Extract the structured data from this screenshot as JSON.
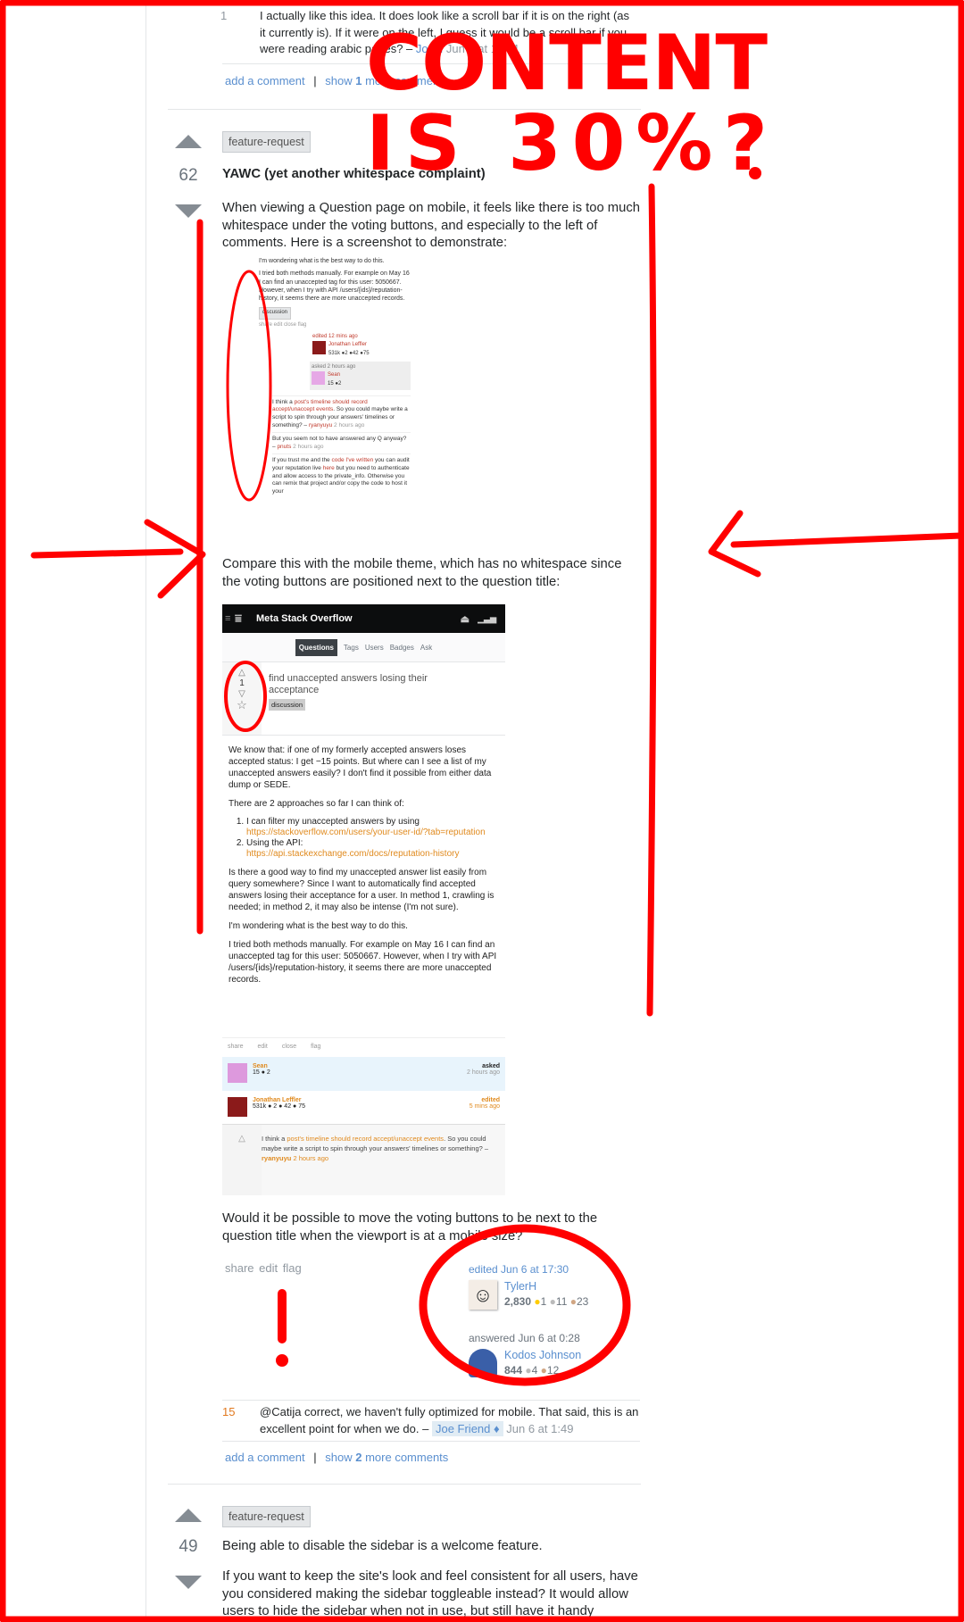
{
  "top_comment": {
    "score": "1",
    "text": "I actually like this idea. It does look like a scroll bar if it is on the right (as it currently is). If it were on the left, I guess it would be a scroll bar if you were reading arabic pages? –",
    "user": "JonH",
    "time": "Jun 7 at 14:51"
  },
  "top_links": {
    "add_comment": "add a comment",
    "sep": "|",
    "show_prefix": "show",
    "show_count": "1",
    "show_suffix": "more comment"
  },
  "answer1": {
    "score": "62",
    "tag": "feature-request",
    "title": "YAWC (yet another whitespace complaint)",
    "intro": "When viewing a Question page on mobile, it feels like there is too much whitespace under the voting buttons, and especially to the left of comments. Here is a screenshot to demonstrate:",
    "compare": "Compare this with the mobile theme, which has no whitespace since the voting buttons are positioned next to the question title:",
    "closing": "Would it be possible to move the voting buttons to be next to the question title when the viewport is at a mobile size?",
    "actions": {
      "share": "share",
      "edit": "edit",
      "flag": "flag"
    },
    "edited": {
      "label": "edited Jun 6 at 17:30",
      "user": "TylerH",
      "rep": "2,830",
      "gold": "1",
      "silver": "11",
      "bronze": "23"
    },
    "answered": {
      "label": "answered Jun 6 at 0:28",
      "user": "Kodos Johnson",
      "rep": "844",
      "silver": "4",
      "bronze": "12"
    },
    "comment": {
      "score": "15",
      "text": "@Catija correct, we haven't fully optimized for mobile. That said, this is an excellent point for when we do. –",
      "user": "Joe Friend ♦",
      "time": "Jun 6 at 1:49"
    },
    "links": {
      "add_comment": "add a comment",
      "sep": "|",
      "show_prefix": "show",
      "show_count": "2",
      "show_suffix": "more comments"
    }
  },
  "screenshot1": {
    "p1": "I'm wondering what is the best way to do this.",
    "p2": "I tried both methods manually. For example on May 16 I can find an unaccepted tag for this user: 5050667. However, when I try with API /users/{ids}/reputation-history, it seems there are more unaccepted records.",
    "tag": "discussion",
    "actions": "share edit close flag",
    "edited": "edited 12 mins ago",
    "editor": "Jonathan Leffler",
    "editor_rep": "531k ●2 ●42 ●75",
    "asked": "asked 2 hours ago",
    "asker": "Sean",
    "asker_rep": "15 ●2",
    "c1_pre": "I think a ",
    "c1_link": "post's timeline should record accept/unaccept events",
    "c1_post": ". So you could maybe write a script to spin through your answers' timelines or something? –",
    "c1_user": "ryanyuyu",
    "c1_time": "2 hours ago",
    "c2": "But you seem not to have answered any Q anyway? –",
    "c2_user": "pnuts",
    "c2_time": "2 hours ago",
    "c3_pre": "If you trust me and the ",
    "c3_link": "code I've written",
    "c3_mid": " you can audit your reputation live ",
    "c3_link2": "here",
    "c3_post": " but you need to authenticate and allow access to the private_info. Otherwise you can remix that project and/or copy the code to host it your"
  },
  "mobile": {
    "site": "Meta Stack Overflow",
    "nav": [
      "Questions",
      "Tags",
      "Users",
      "Badges",
      "Ask"
    ],
    "votes": "1",
    "title": "find unaccepted answers losing their acceptance",
    "tag": "discussion",
    "p1": "We know that: if one of my formerly accepted answers loses accepted status: I get −15 points. But where can I see a list of my unaccepted answers easily? I don't find it possible from either data dump or SEDE.",
    "p2": "There are 2 approaches so far I can think of:",
    "li1": "I can filter my unaccepted answers by using",
    "li1_link": "https://stackoverflow.com/users/your-user-id/?tab=reputation",
    "li2": "Using the API:",
    "li2_link": "https://api.stackexchange.com/docs/reputation-history",
    "p3": "Is there a good way to find my unaccepted answer list easily from query somewhere? Since I want to automatically find accepted answers losing their acceptance for a user. In method 1, crawling is needed; in method 2, it may also be intense (I'm not sure).",
    "p4": "I'm wondering what is the best way to do this.",
    "p5": "I tried both methods manually. For example on May 16 I can find an unaccepted tag for this user: 5050667. However, when I try with API /users/{ids}/reputation-history, it seems there are more unaccepted records.",
    "actions": [
      "share",
      "edit",
      "close",
      "flag"
    ],
    "asker": "Sean",
    "asker_rep": "15 ● 2",
    "asked": "asked",
    "asked_time": "2 hours ago",
    "editor": "Jonathan Leffler",
    "editor_rep": "531k ● 2 ● 42 ● 75",
    "edited": "edited",
    "edited_time": "5 mins ago",
    "comment_pre": "I think a ",
    "comment_link": "post's timeline should record accept/unaccept events",
    "comment_post": ". So you could maybe write a script to spin through your answers' timelines or something? –",
    "comment_user": "ryanyuyu",
    "comment_time": "2 hours ago"
  },
  "answer2": {
    "score": "49",
    "tag": "feature-request",
    "p1": "Being able to disable the sidebar is a welcome feature.",
    "p2": "If you want to keep the site's look and feel consistent for all users, have you considered making the sidebar toggleable instead? It would allow users to hide the sidebar when not in use, but still have it handy"
  },
  "annotation": {
    "line1": "CONTENT",
    "line2": "IS 30%?",
    "color": "#ff0000"
  }
}
